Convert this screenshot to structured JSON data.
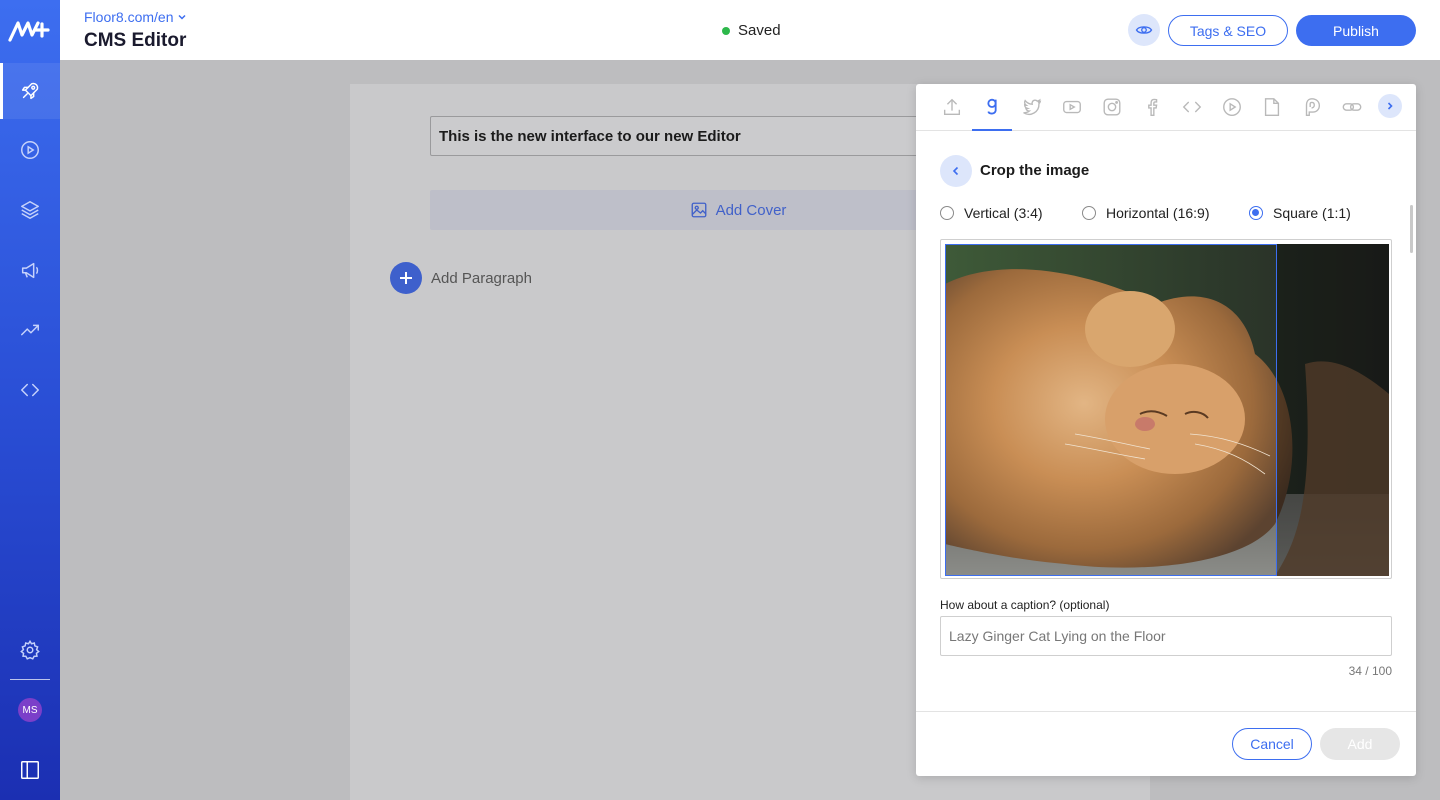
{
  "header": {
    "site_link": "Floor8.com/en",
    "title": "CMS Editor",
    "status": "Saved",
    "tags_seo_label": "Tags & SEO",
    "publish_label": "Publish"
  },
  "sidebar": {
    "items": [
      {
        "icon": "rocket-icon"
      },
      {
        "icon": "play-icon"
      },
      {
        "icon": "layers-icon"
      },
      {
        "icon": "megaphone-icon"
      },
      {
        "icon": "trending-icon"
      },
      {
        "icon": "code-icon"
      }
    ],
    "avatar_initials": "MS"
  },
  "editor": {
    "title_value": "This is the new interface to our new Editor",
    "add_cover_label": "Add Cover",
    "add_paragraph_label": "Add Paragraph"
  },
  "panel": {
    "tabs": [
      "upload-icon",
      "getty-icon",
      "twitter-icon",
      "youtube-icon",
      "instagram-icon",
      "facebook-icon",
      "code-icon",
      "video-icon",
      "document-icon",
      "poll-icon",
      "link-icon"
    ],
    "active_tab": "getty-icon",
    "crop_title": "Crop the image",
    "ratios": [
      {
        "label": "Vertical (3:4)",
        "checked": false
      },
      {
        "label": "Horizontal (16:9)",
        "checked": false
      },
      {
        "label": "Square (1:1)",
        "checked": true
      }
    ],
    "caption_label": "How about a caption? (optional)",
    "caption_value": "Lazy Ginger Cat Lying on the Floor",
    "caption_counter": "34 / 100",
    "cancel_label": "Cancel",
    "add_label": "Add"
  },
  "colors": {
    "accent": "#3d6ef0",
    "status_dot": "#2db84b"
  }
}
